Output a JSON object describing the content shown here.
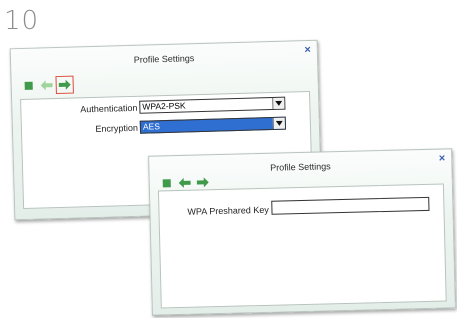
{
  "step": {
    "number": "10"
  },
  "dialog1": {
    "title": "Profile Settings",
    "close_glyph": "×",
    "toolbar": [
      {
        "name": "stop-icon"
      },
      {
        "name": "back-arrow-icon"
      },
      {
        "name": "forward-arrow-icon",
        "highlighted": true
      }
    ],
    "authentication": {
      "label": "Authentication",
      "value": "WPA2-PSK"
    },
    "encryption": {
      "label": "Encryption",
      "value": "AES"
    }
  },
  "dialog2": {
    "title": "Profile Settings",
    "close_glyph": "×",
    "toolbar": [
      {
        "name": "stop-icon"
      },
      {
        "name": "back-arrow-icon"
      },
      {
        "name": "forward-arrow-icon"
      }
    ],
    "preshared_key": {
      "label": "WPA Preshared Key",
      "value": ""
    }
  },
  "colors": {
    "accent_green": "#3f9a4a",
    "back_arrow_green": "#9fd49a",
    "highlight_red": "#e04a3a",
    "selection_blue": "#2f6fd1",
    "close_blue": "#3b5fae"
  }
}
